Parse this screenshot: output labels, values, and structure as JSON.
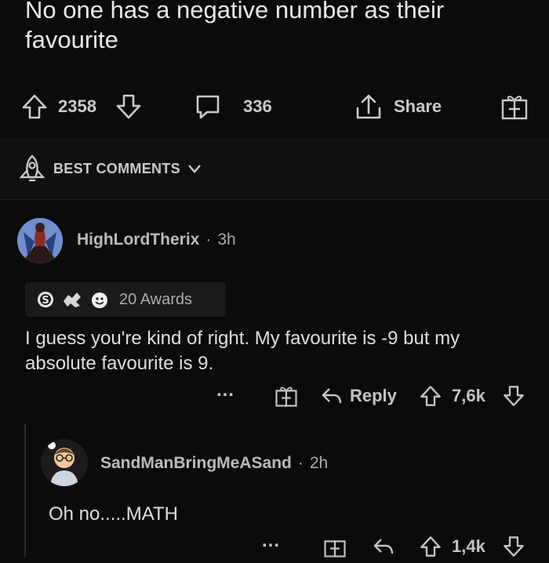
{
  "post": {
    "title": "No one has a negative number as their favourite",
    "upvotes": "2358",
    "comments": "336",
    "share_label": "Share"
  },
  "sort": {
    "label": "BEST COMMENTS"
  },
  "comments": [
    {
      "author": "HighLordTherix",
      "separator": "·",
      "time": "3h",
      "awards_label": "20 Awards",
      "body": "I guess you're kind of right. My favourite is -9 but my absolute favourite is 9.",
      "more": "...",
      "reply_label": "Reply",
      "votes": "7,6k"
    },
    {
      "author": "SandManBringMeASand",
      "separator": "·",
      "time": "2h",
      "body": "Oh no.....MATH",
      "more": "...",
      "votes": "1,4k"
    }
  ],
  "colors": {
    "background": "#0b0b0b",
    "text": "#d7dadc",
    "muted": "#a9acaf"
  }
}
